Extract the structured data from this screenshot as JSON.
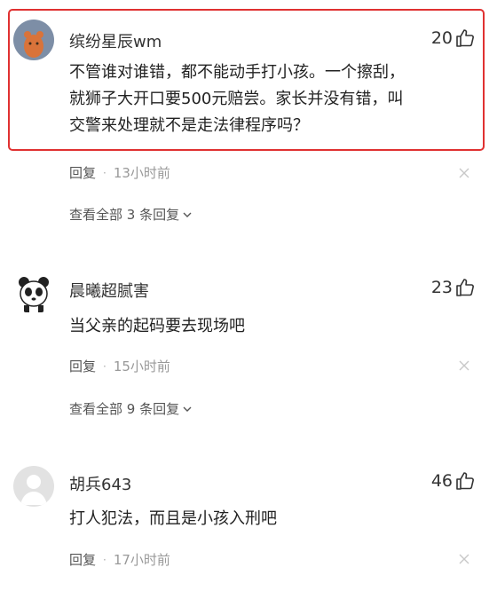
{
  "comments": [
    {
      "username": "缤纷星辰wm",
      "likes": "20",
      "text_lines": [
        "不管谁对谁错，都不能动手打小孩。一个擦刮，",
        "就狮子大开口要500元赔尝。家长并没有错，叫",
        "交警来处理就不是走法律程序吗？"
      ],
      "reply_label": "回复",
      "time": "13小时前",
      "view_all": "查看全部 3 条回复"
    },
    {
      "username": "晨曦超腻害",
      "likes": "23",
      "text_lines": [
        "当父亲的起码要去现场吧"
      ],
      "reply_label": "回复",
      "time": "15小时前",
      "view_all": "查看全部 9 条回复"
    },
    {
      "username": "胡兵643",
      "likes": "46",
      "text_lines": [
        "打人犯法，而且是小孩入刑吧"
      ],
      "reply_label": "回复",
      "time": "17小时前"
    }
  ],
  "colors": {
    "highlight_border": "#e03131"
  },
  "icons": {
    "like": "thumbs-up-icon",
    "close": "close-icon",
    "expand": "chevron-down-icon"
  }
}
